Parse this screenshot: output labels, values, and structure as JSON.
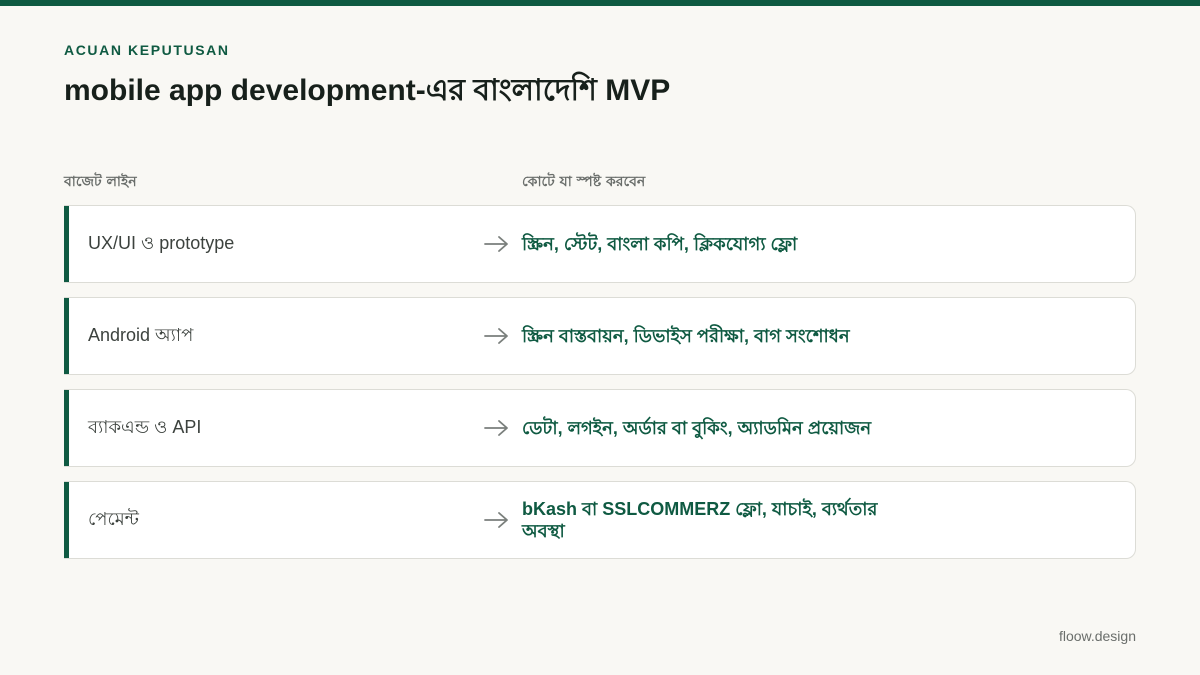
{
  "header": {
    "eyebrow": "ACUAN KEPUTUSAN",
    "title": "mobile app development-এর বাংলাদেশি MVP"
  },
  "columns": {
    "left": "বাজেট লাইন",
    "right": "কোটে যা স্পষ্ট করবেন"
  },
  "rows": [
    {
      "label": "UX/UI ও prototype",
      "detail": "স্ক্রিন, স্টেট, বাংলা কপি, ক্লিকযোগ্য ফ্লো"
    },
    {
      "label": "Android অ্যাপ",
      "detail": "স্ক্রিন বাস্তবায়ন, ডিভাইস পরীক্ষা, বাগ সংশোধন"
    },
    {
      "label": "ব্যাকএন্ড ও API",
      "detail": "ডেটা, লগইন, অর্ডার বা বুকিং, অ্যাডমিন প্রয়োজন"
    },
    {
      "label": "পেমেন্ট",
      "detail": "bKash বা SSLCOMMERZ ফ্লো, যাচাই, ব্যর্থতার অবস্থা"
    }
  ],
  "icons": {
    "row_arrow": "arrow-right-icon"
  },
  "colors": {
    "accent": "#0f5a42",
    "background": "#f9f8f4"
  },
  "footer": {
    "brand": "floow.design"
  }
}
